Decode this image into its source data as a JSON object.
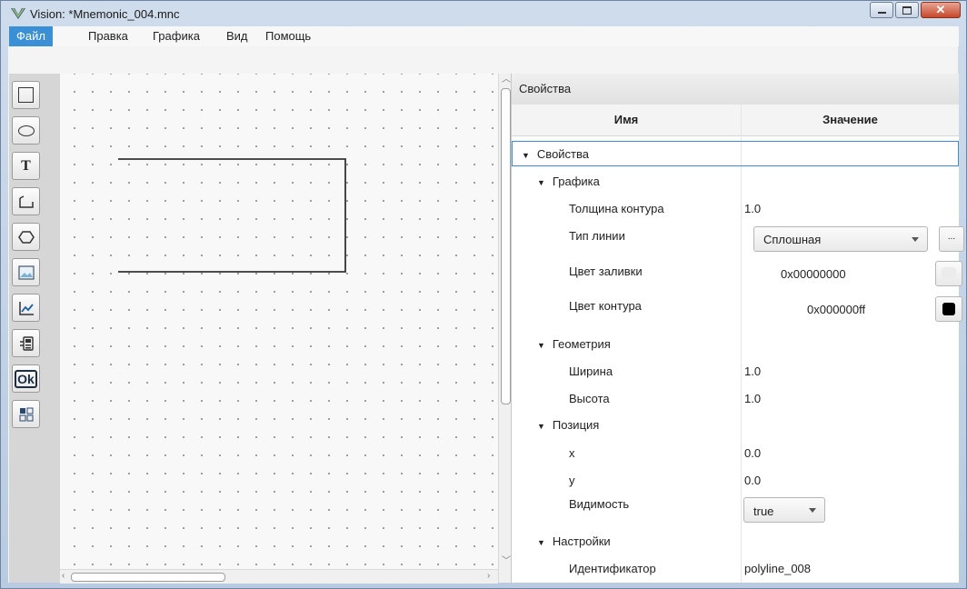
{
  "window": {
    "title": "Vision: *Mnemonic_004.mnc"
  },
  "menu": {
    "file": "Файл",
    "edit": "Правка",
    "graphics": "Графика",
    "view": "Вид",
    "help": "Помощь"
  },
  "tools": [
    {
      "name": "rectangle-tool-button",
      "icon": "rectangle-icon"
    },
    {
      "name": "ellipse-tool-button",
      "icon": "ellipse-icon"
    },
    {
      "name": "text-tool-button",
      "icon": "text-icon",
      "glyph": "T"
    },
    {
      "name": "polyline-tool-button",
      "icon": "polyline-icon"
    },
    {
      "name": "polygon-tool-button",
      "icon": "hexagon-icon"
    },
    {
      "name": "image-tool-button",
      "icon": "image-icon"
    },
    {
      "name": "chart-tool-button",
      "icon": "chart-icon"
    },
    {
      "name": "widget-tool-button",
      "icon": "device-icon"
    },
    {
      "name": "ok-button-tool",
      "icon": "ok-icon",
      "glyph": "Ok"
    },
    {
      "name": "grid-tool-button",
      "icon": "grid-icon"
    }
  ],
  "properties": {
    "panel_title": "Свойства",
    "col_name": "Имя",
    "col_value": "Значение",
    "root": "Свойства",
    "graphics": {
      "label": "Графика",
      "stroke_width_label": "Толщина контура",
      "stroke_width": "1.0",
      "line_type_label": "Тип линии",
      "line_type": "Сплошная",
      "more_button": "...",
      "fill_color_label": "Цвет заливки",
      "fill_color": "0x00000000",
      "fill_swatch": "#ececec",
      "stroke_color_label": "Цвет контура",
      "stroke_color": "0x000000ff",
      "stroke_swatch": "#000000"
    },
    "geometry": {
      "label": "Геометрия",
      "width_label": "Ширина",
      "width": "1.0",
      "height_label": "Высота",
      "height": "1.0"
    },
    "position": {
      "label": "Позиция",
      "x_label": "x",
      "x": "0.0",
      "y_label": "y",
      "y": "0.0",
      "visible_label": "Видимость",
      "visible": "true"
    },
    "settings": {
      "label": "Настройки",
      "id_label": "Идентификатор",
      "id": "polyline_008"
    }
  },
  "colors": {
    "accent": "#3a8fd6",
    "close": "#c7482b"
  }
}
